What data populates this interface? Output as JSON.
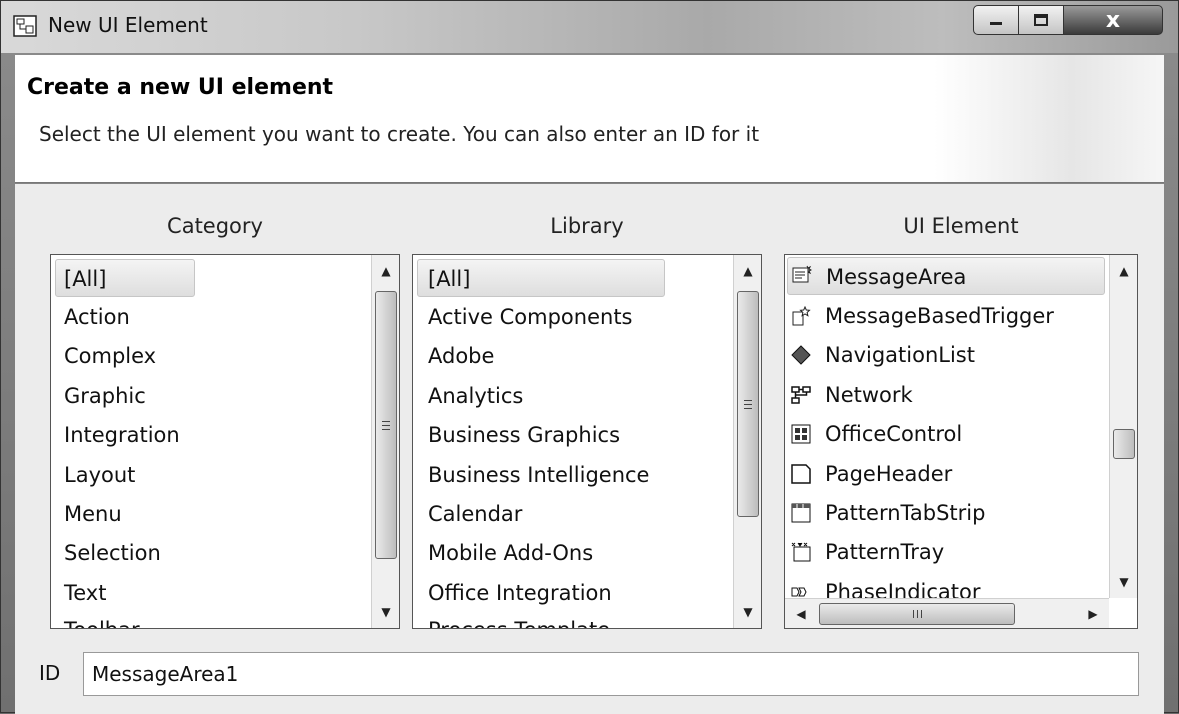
{
  "window": {
    "title": "New UI Element",
    "close_glyph": "x"
  },
  "header": {
    "title": "Create a new UI element",
    "description": "Select the UI element you want to create. You can also enter an ID for it"
  },
  "columns": {
    "category_label": "Category",
    "library_label": "Library",
    "element_label": "UI Element"
  },
  "category": {
    "items": [
      "[All]",
      "Action",
      "Complex",
      "Graphic",
      "Integration",
      "Layout",
      "Menu",
      "Selection",
      "Text",
      "Toolbar"
    ],
    "selected": "[All]"
  },
  "library": {
    "items": [
      "[All]",
      "Active Components",
      "Adobe",
      "Analytics",
      "Business Graphics",
      "Business Intelligence",
      "Calendar",
      "Mobile Add-Ons",
      "Office Integration",
      "Process Template"
    ],
    "selected": "[All]"
  },
  "ui_elements": {
    "items": [
      {
        "label": "MessageArea",
        "icon": "message-area-icon"
      },
      {
        "label": "MessageBasedTrigger",
        "icon": "trigger-icon"
      },
      {
        "label": "NavigationList",
        "icon": "diamond-icon"
      },
      {
        "label": "Network",
        "icon": "network-icon"
      },
      {
        "label": "OfficeControl",
        "icon": "office-control-icon"
      },
      {
        "label": "PageHeader",
        "icon": "page-icon"
      },
      {
        "label": "PatternTabStrip",
        "icon": "tabstrip-icon"
      },
      {
        "label": "PatternTray",
        "icon": "tray-icon"
      },
      {
        "label": "PhaseIndicator",
        "icon": "phase-indicator-icon"
      }
    ],
    "selected": "MessageArea"
  },
  "id_field": {
    "label": "ID",
    "value": "MessageArea1"
  },
  "scroll_glyphs": {
    "up": "▲",
    "down": "▼",
    "left": "◀",
    "right": "▶"
  }
}
